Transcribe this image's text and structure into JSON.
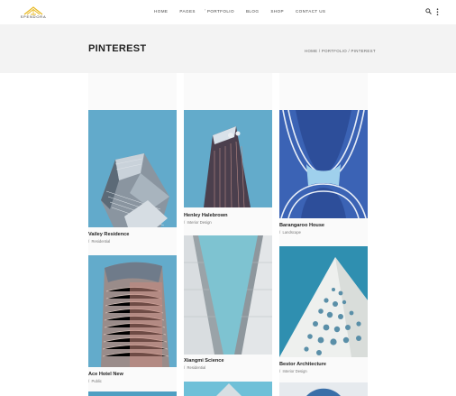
{
  "brand": {
    "name": "SPENDORA"
  },
  "nav": {
    "items": [
      "HOME",
      "PAGES",
      "PORTFOLIO",
      "BLOG",
      "SHOP",
      "CONTACT US"
    ]
  },
  "page": {
    "title": "PINTEREST",
    "breadcrumb": "HOME  /  PORTFOLIO  /  PINTEREST"
  },
  "gallery": [
    {
      "title": "Vailey Residence",
      "category": "Residential"
    },
    {
      "title": "Henley Halebrown",
      "category": "Interior Design"
    },
    {
      "title": "Barangaroo House",
      "category": "Landscape"
    },
    {
      "title": "Ace Hotel New",
      "category": "Public"
    },
    {
      "title": "Xiangmi Science",
      "category": "Residential"
    },
    {
      "title": "Bestor Architecture",
      "category": "Interior Design"
    }
  ],
  "colors": {
    "accent": "#e8b923",
    "sky": "#5fa9c9",
    "band": "#f3f3f3"
  }
}
